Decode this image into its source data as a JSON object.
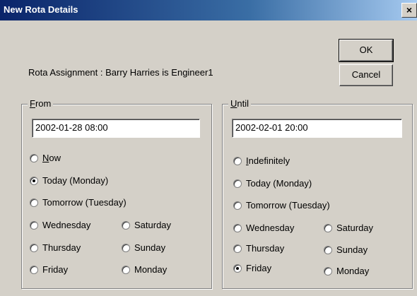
{
  "window": {
    "title": "New Rota Details",
    "close_glyph": "×"
  },
  "assignment_text": "Rota Assignment : Barry Harries is Engineer1",
  "buttons": {
    "ok": "OK",
    "cancel": "Cancel"
  },
  "from": {
    "label_mnemonic": "F",
    "label_rest": "rom",
    "value": "2002-01-28 08:00",
    "options": {
      "now_mnemonic": "N",
      "now_rest": "ow",
      "today": "Today (Monday)",
      "tomorrow": "Tomorrow (Tuesday)",
      "wednesday": "Wednesday",
      "saturday": "Saturday",
      "thursday": "Thursday",
      "sunday": "Sunday",
      "friday": "Friday",
      "monday": "Monday"
    },
    "selected": "today"
  },
  "until": {
    "label_mnemonic": "U",
    "label_rest": "ntil",
    "value": "2002-02-01 20:00",
    "options": {
      "indef_mnemonic": "I",
      "indef_rest": "ndefinitely",
      "today": "Today (Monday)",
      "tomorrow": "Tomorrow (Tuesday)",
      "wednesday": "Wednesday",
      "saturday": "Saturday",
      "thursday": "Thursday",
      "sunday": "Sunday",
      "friday": "Friday",
      "monday": "Monday"
    },
    "selected": "friday"
  }
}
